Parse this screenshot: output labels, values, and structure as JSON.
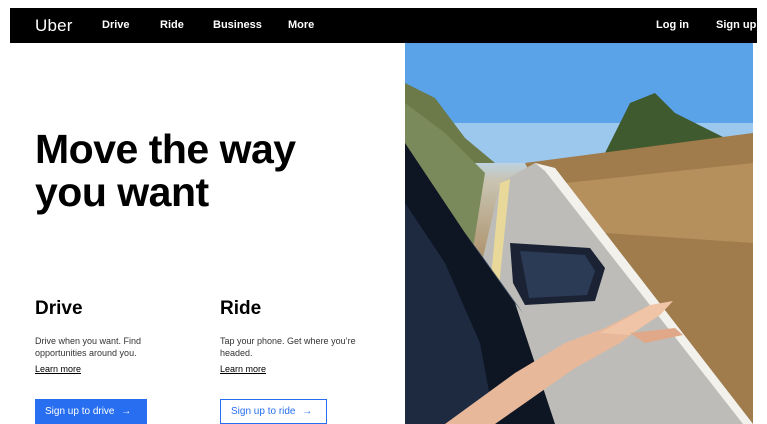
{
  "nav": {
    "logo": "Uber",
    "links": [
      "Drive",
      "Ride",
      "Business",
      "More"
    ],
    "login": "Log in",
    "signup": "Sign up"
  },
  "hero": {
    "title_line1": "Move the way",
    "title_line2": "you want"
  },
  "drive": {
    "heading": "Drive",
    "description": "Drive when you want. Find opportunities around you.",
    "learn_more": "Learn more",
    "cta": "Sign up to drive"
  },
  "ride": {
    "heading": "Ride",
    "description": "Tap your phone. Get where you’re headed.",
    "learn_more": "Learn more",
    "cta": "Sign up to ride"
  },
  "icons": {
    "arrow": "→"
  },
  "colors": {
    "nav_bg": "#000000",
    "accent": "#276ef1"
  }
}
